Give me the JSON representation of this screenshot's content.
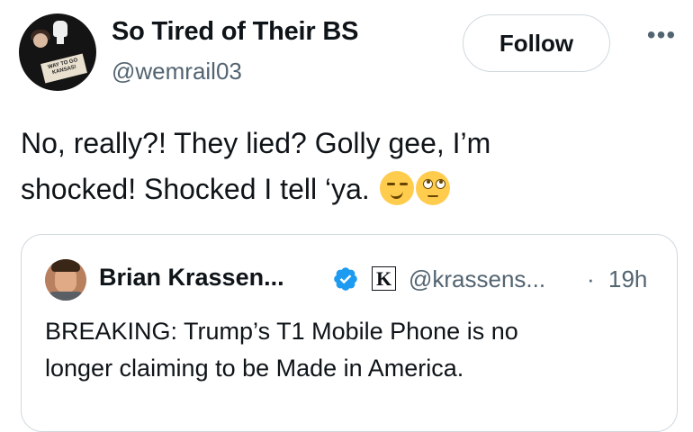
{
  "author": {
    "name": "So Tired of Their BS",
    "handle": "@wemrail03",
    "avatar_sign_text": "WAY TO GO KANSAS!"
  },
  "follow_button_label": "Follow",
  "more_label": "•••",
  "tweet": {
    "line1": "No, really?! They lied? Golly gee, I’m",
    "line2": "shocked! Shocked I tell ‘ya.",
    "emojis": [
      "smirking-face",
      "face-with-rolling-eyes"
    ]
  },
  "quoted": {
    "name": "Brian Krassen...",
    "verified": true,
    "affiliate_badge": "K",
    "handle": "@krassens...",
    "dot": "·",
    "time": "19h",
    "line1": "BREAKING:  Trump’s T1 Mobile Phone is no",
    "line2": "longer claiming to be Made in America."
  },
  "colors": {
    "verified_blue": "#1d9bf0",
    "secondary_text": "#536471",
    "border": "#cfd9de"
  }
}
